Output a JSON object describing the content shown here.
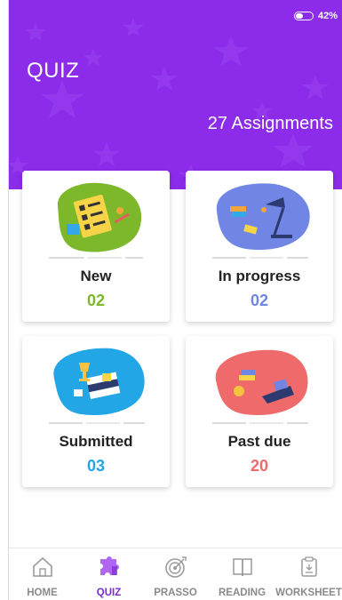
{
  "status_bar": {
    "battery_text": "42%",
    "battery_level": 0.42
  },
  "header": {
    "title": "QUIZ",
    "assignments_label": "27 Assignments"
  },
  "colors": {
    "header_bg": "#8c2bea",
    "new": "#7cb82a",
    "in_progress": "#7185e5",
    "submitted": "#22a6e6",
    "past_due": "#ef6b6b",
    "nav_active": "#7b2bd6",
    "nav_inactive": "#8a8a8a"
  },
  "cards": [
    {
      "label": "New",
      "value": "02",
      "icon": "checklist-art-icon"
    },
    {
      "label": "In progress",
      "value": "02",
      "icon": "lamp-books-art-icon"
    },
    {
      "label": "Submitted",
      "value": "03",
      "icon": "trophy-books-art-icon"
    },
    {
      "label": "Past due",
      "value": "20",
      "icon": "clock-books-art-icon"
    }
  ],
  "nav": [
    {
      "label": "HOME",
      "icon": "home-icon"
    },
    {
      "label": "QUIZ",
      "icon": "puzzle-icon",
      "active": true
    },
    {
      "label": "PRASSO",
      "icon": "target-icon"
    },
    {
      "label": "READING",
      "icon": "book-icon"
    },
    {
      "label": "WORKSHEET",
      "icon": "clipboard-icon"
    }
  ]
}
